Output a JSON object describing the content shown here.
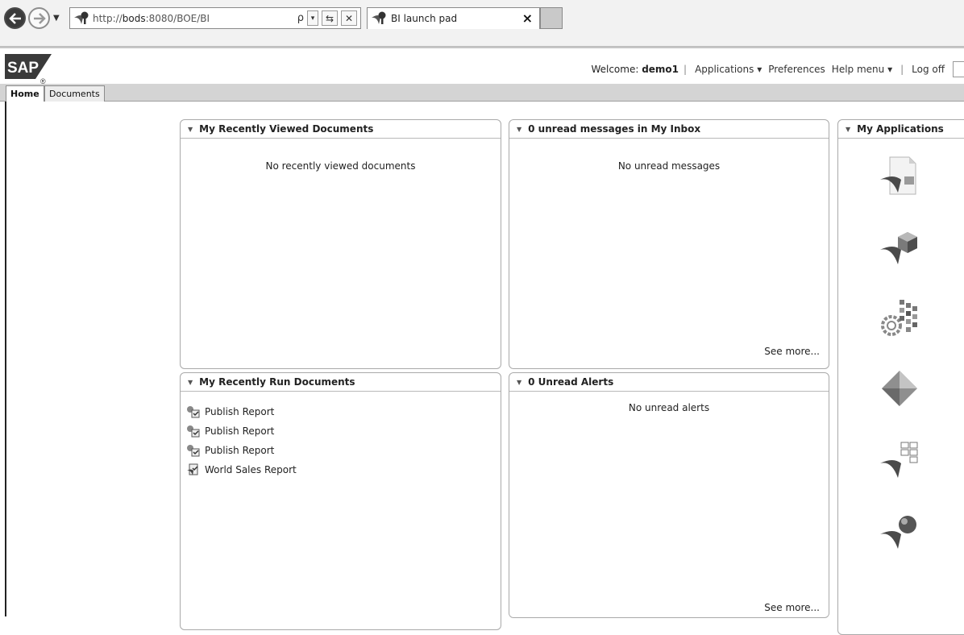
{
  "browser": {
    "url_prefix": "http://",
    "url_host": "bods",
    "url_rest": ":8080/BOE/BI",
    "search_glyph": "ρ",
    "dropdown_glyph": "▾",
    "refresh_glyph": "⇆",
    "stop_glyph": "✕",
    "tab_title": "BI launch pad",
    "tab_close": "×"
  },
  "header": {
    "logo_text": "SAP",
    "registered_mark": "®",
    "welcome_prefix": "Welcome:",
    "username": "demo1",
    "applications": "Applications ▾",
    "preferences": "Preferences",
    "help_menu": "Help menu ▾",
    "log_off": "Log off",
    "separator": "|"
  },
  "tabs": {
    "home": "Home",
    "documents": "Documents"
  },
  "panels": {
    "recently_viewed": {
      "title": "My Recently Viewed Documents",
      "message": "No recently viewed documents"
    },
    "inbox": {
      "title": "0 unread messages in My Inbox",
      "message": "No unread messages",
      "see_more": "See more..."
    },
    "applications": {
      "title": "My Applications",
      "icons": [
        "webi-document-icon",
        "crystal-reports-icon",
        "cmc-settings-icon",
        "diamond-app-icon",
        "dashboard-app-icon",
        "explorer-sphere-icon"
      ]
    },
    "recently_run": {
      "title": "My Recently Run Documents",
      "items": [
        {
          "label": "Publish Report",
          "icon": "publication-icon"
        },
        {
          "label": "Publish Report",
          "icon": "publication-icon"
        },
        {
          "label": "Publish Report",
          "icon": "publication-icon"
        },
        {
          "label": "World Sales Report",
          "icon": "report-icon"
        }
      ]
    },
    "alerts": {
      "title": "0 Unread Alerts",
      "message": "No unread alerts",
      "see_more": "See more..."
    }
  },
  "caret_glyph": "▼",
  "colors": {
    "chrome_bg": "#f2f2f2",
    "tab_strip_bg": "#d4d4d4",
    "panel_border": "#a9a9a9"
  }
}
